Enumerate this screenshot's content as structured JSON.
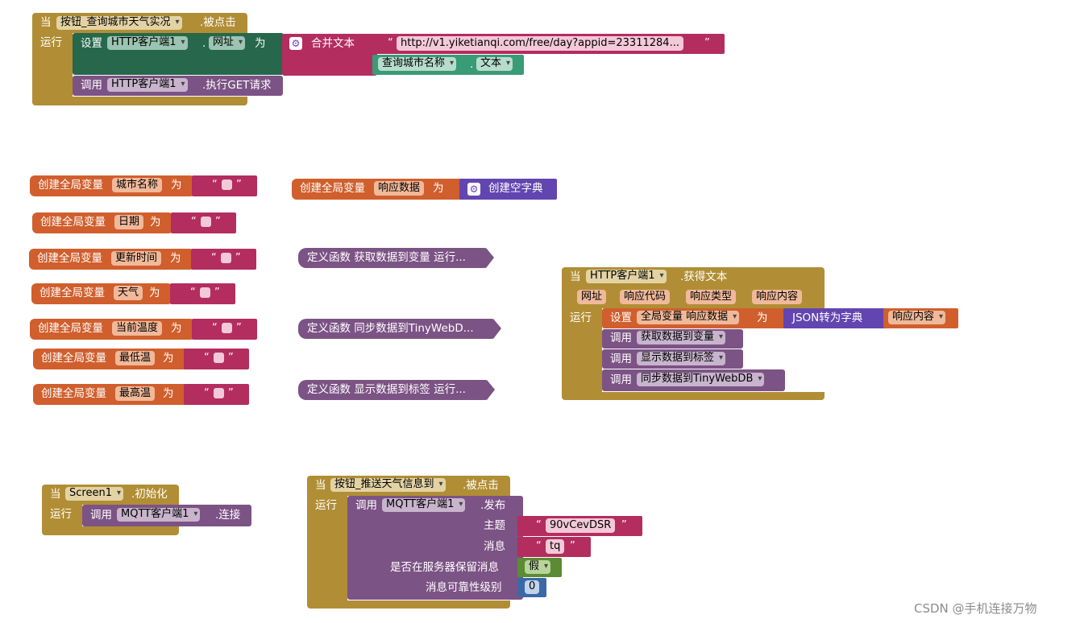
{
  "colors": {
    "event": "#b18e35",
    "var": "#d05f2d",
    "text": "#b32d5e",
    "proc": "#7c5385",
    "dict": "#6245b0",
    "logic": "#5b8b34",
    "math": "#3b69a7",
    "comp": "#27674c",
    "comp_text": "#3a9b77"
  },
  "ev1": {
    "when": "当",
    "button": "按钮_查询城市天气实况",
    "clicked": ".被点击",
    "run": "运行",
    "set": "设置",
    "client": "HTTP客户端1",
    "dot": ".",
    "url": "网址",
    "to": "为",
    "join": "合并文本",
    "url_text": "http://v1.yiketianqi.com/free/day?appid=23311284...",
    "city_input": "查询城市名称",
    "text_prop": "文本",
    "call": "调用",
    "client2": "HTTP客户端1",
    "get": ".执行GET请求"
  },
  "globals": [
    {
      "label": "创建全局变量",
      "name": "城市名称",
      "to": "为"
    },
    {
      "label": "创建全局变量",
      "name": "日期",
      "to": "为"
    },
    {
      "label": "创建全局变量",
      "name": "更新时间",
      "to": "为"
    },
    {
      "label": "创建全局变量",
      "name": "天气",
      "to": "为"
    },
    {
      "label": "创建全局变量",
      "name": "当前温度",
      "to": "为"
    },
    {
      "label": "创建全局变量",
      "name": "最低温",
      "to": "为"
    },
    {
      "label": "创建全局变量",
      "name": "最高温",
      "to": "为"
    }
  ],
  "resp_var": {
    "label": "创建全局变量",
    "name": "响应数据",
    "to": "为",
    "dict": "创建空字典"
  },
  "procs": [
    "定义函数 获取数据到变量 运行...",
    "定义函数 同步数据到TinyWebD...",
    "定义函数 显示数据到标签 运行..."
  ],
  "ev2": {
    "when": "当",
    "client": "HTTP客户端1",
    "got": ".获得文本",
    "params": [
      "网址",
      "响应代码",
      "响应类型",
      "响应内容"
    ],
    "run": "运行",
    "set": "设置",
    "var": "全局变量 响应数据",
    "to": "为",
    "json": "JSON转为字典",
    "content": "响应内容",
    "call": "调用",
    "fn1": "获取数据到变量",
    "fn2": "显示数据到标签",
    "fn3": "同步数据到TinyWebDB"
  },
  "ev3": {
    "when": "当",
    "screen": "Screen1",
    "init": ".初始化",
    "run": "运行",
    "call": "调用",
    "mqtt": "MQTT客户端1",
    "connect": ".连接"
  },
  "ev4": {
    "when": "当",
    "button": "按钮_推送天气信息到",
    "clicked": ".被点击",
    "run": "运行",
    "call": "调用",
    "mqtt": "MQTT客户端1",
    "publish": ".发布",
    "topic_label": "主题",
    "topic": "90vCevDSR",
    "msg_label": "消息",
    "msg": "tq",
    "retain_label": "是否在服务器保留消息",
    "retain": "假",
    "qos_label": "消息可靠性级别",
    "qos": "0"
  },
  "quote": "“",
  "quote_close": "”",
  "watermark": "CSDN @手机连接万物"
}
